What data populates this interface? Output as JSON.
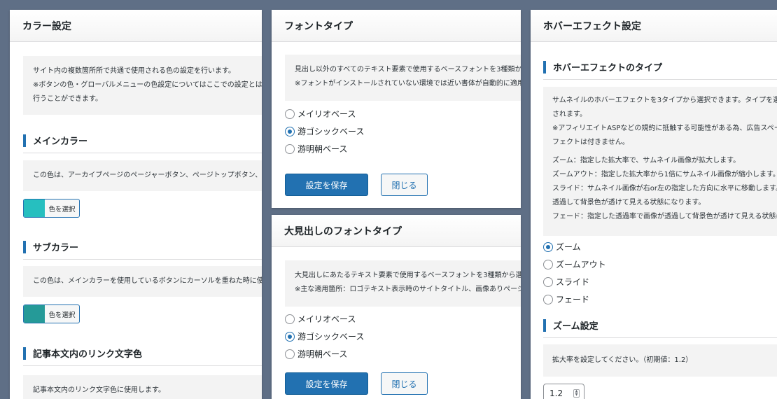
{
  "color_panel": {
    "title": "カラー設定",
    "intro_lines": [
      "サイト内の複数箇所所で共通で使用される色の設定を行います。",
      "※ボタンの色・グローバルメニューの色設定についてはここでの設定とは別",
      "行うことができます。"
    ],
    "main_color": {
      "heading": "メインカラー",
      "desc": "この色は、アーカイブページのページャーボタン、ページトップボタン、お",
      "button_label": "色を選択",
      "swatch": "#26bfbf"
    },
    "sub_color": {
      "heading": "サブカラー",
      "desc": "この色は、メインカラーを使用しているボタンにカーソルを重ねた時に使用",
      "button_label": "色を選択",
      "swatch": "#259a98"
    },
    "link_color": {
      "heading": "記事本文内のリンク文字色",
      "desc": "記事本文内のリンク文字色に使用します。"
    }
  },
  "font_panel": {
    "title": "フォントタイプ",
    "intro_lines": [
      "見出し以外のすべてのテキスト要素で使用するベースフォントを3種類から",
      "※フォントがインストールされていない環境では近い書体が自動的に適用さ"
    ],
    "options": [
      "メイリオベース",
      "游ゴシックベース",
      "游明朝ベース"
    ],
    "selected_index": 1,
    "save_label": "設定を保存",
    "close_label": "閉じる"
  },
  "heading_font_panel": {
    "title": "大見出しのフォントタイプ",
    "intro_lines": [
      "大見出しにあたるテキスト要素で使用するベースフォントを3種類から選択",
      "※主な適用箇所：ロゴテキスト表示時のサイトタイトル、画像ありページ"
    ],
    "options": [
      "メイリオベース",
      "游ゴシックベース",
      "游明朝ベース"
    ],
    "selected_index": 1,
    "save_label": "設定を保存",
    "close_label": "閉じる"
  },
  "hover_panel": {
    "title": "ホバーエフェクト設定",
    "type_heading": "ホバーエフェクトのタイプ",
    "desc_lines": [
      "サムネイルのホバーエフェクトを3タイプから選択できます。タイプを選",
      "されます。",
      "※アフィリエイトASPなどの規約に抵触する可能性がある為、広告スペー",
      "フェクトは付きません。",
      "ズーム：指定した拡大率で、サムネイル画像が拡大します。",
      "ズームアウト：指定した拡大率から1倍にサムネイル画像が縮小します。",
      "スライド：サムネイル画像が右or左の指定した方向に水平に移動します。",
      "透過して背景色が透けて見える状態になります。",
      "フェード：指定した透過率で画像が透過して背景色が透けて見える状態に"
    ],
    "options": [
      "ズーム",
      "ズームアウト",
      "スライド",
      "フェード"
    ],
    "selected_index": 0,
    "zoom_heading": "ズーム設定",
    "zoom_desc": "拡大率を設定してください。（初期値：1.2）",
    "zoom_value": "1.2"
  }
}
